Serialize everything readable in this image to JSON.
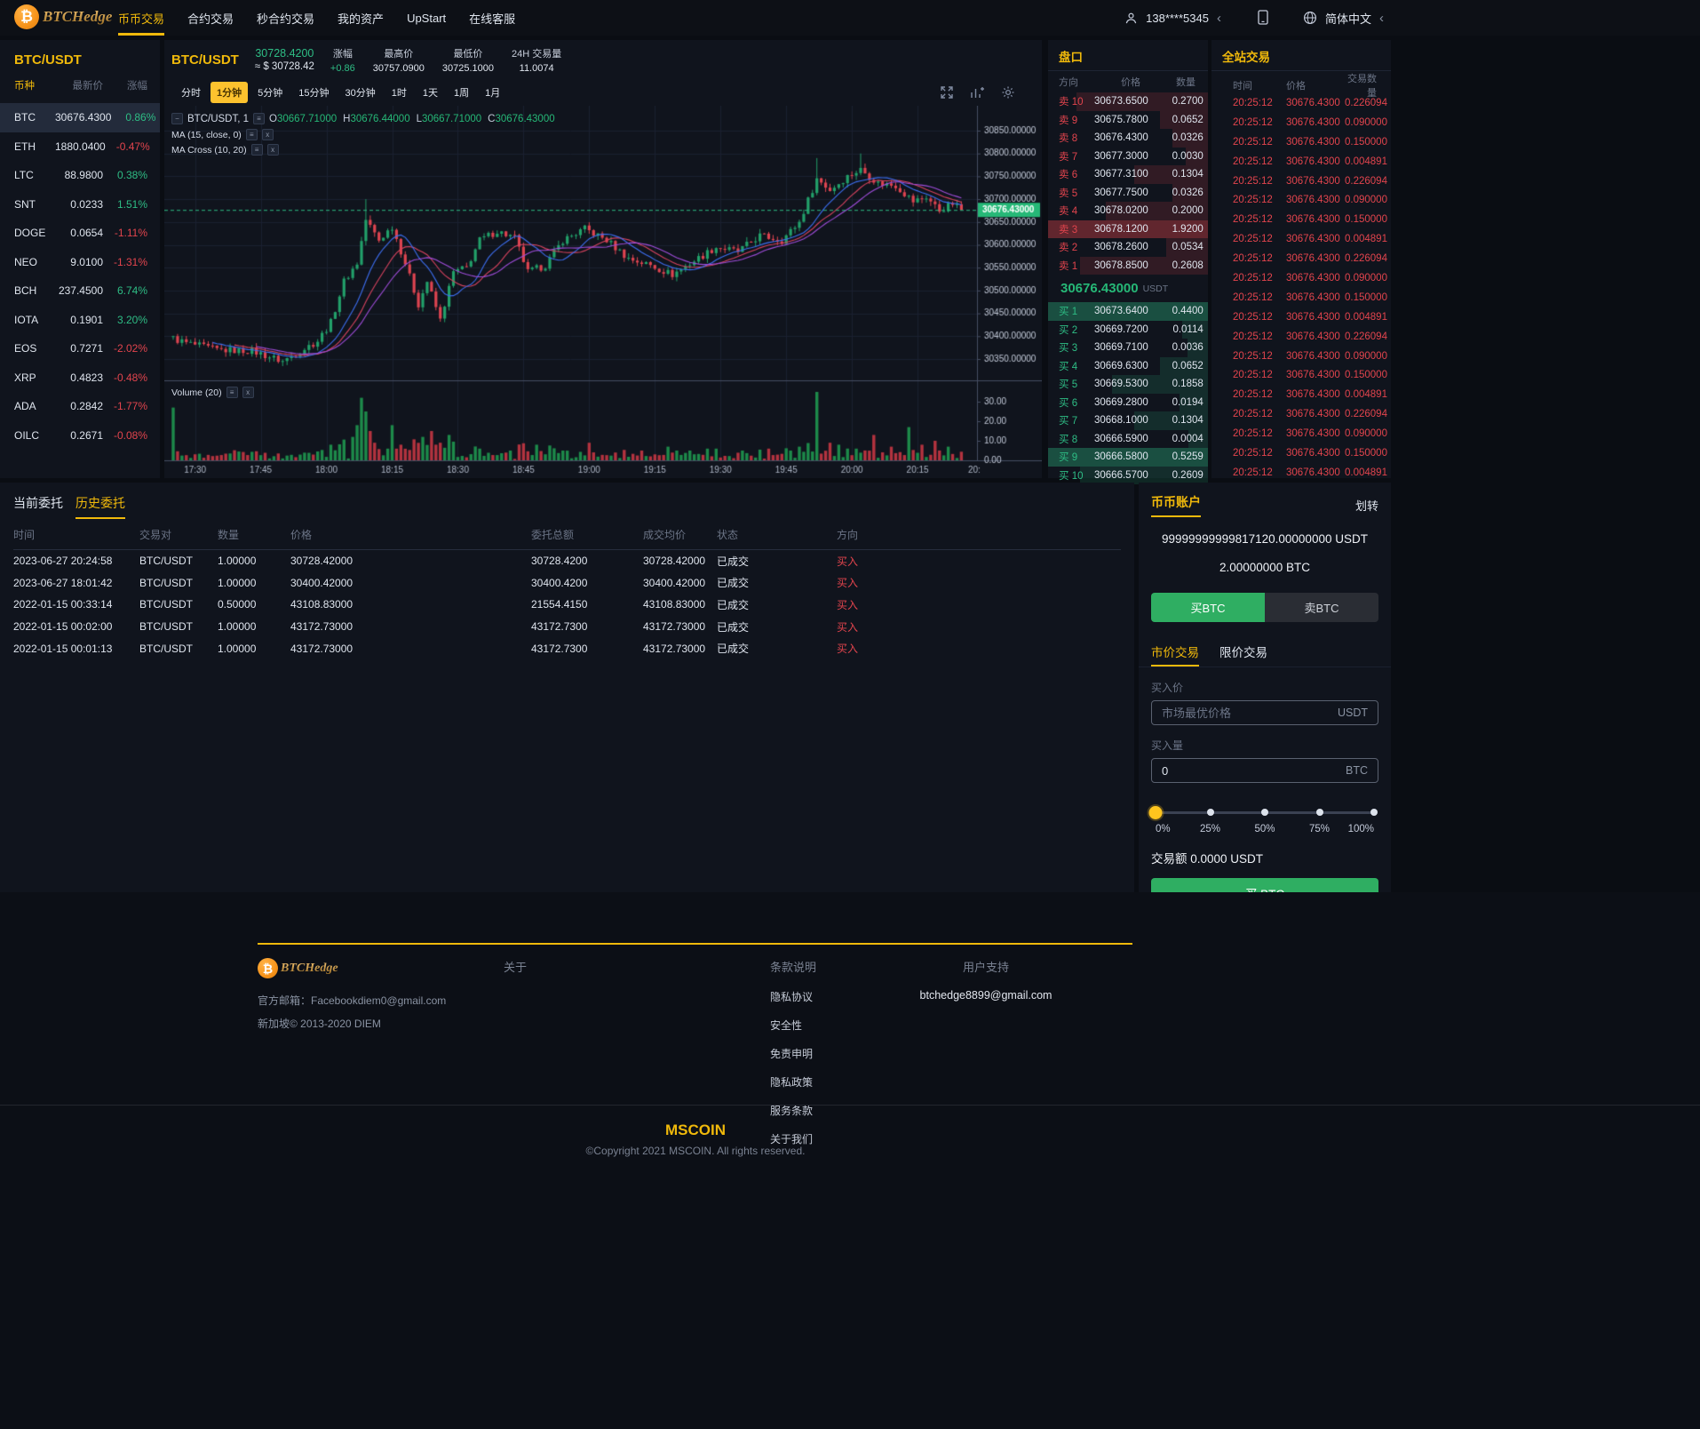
{
  "navbar": {
    "brand": "BTCHedge",
    "items": [
      {
        "label": "币币交易",
        "active": true
      },
      {
        "label": "合约交易",
        "active": false
      },
      {
        "label": "秒合约交易",
        "active": false
      },
      {
        "label": "我的资产",
        "active": false
      },
      {
        "label": "UpStart",
        "active": false
      },
      {
        "label": "在线客服",
        "active": false
      }
    ],
    "user": "138****5345",
    "language": "简体中文"
  },
  "sidebar": {
    "title": "BTC/USDT",
    "headers": [
      "币种",
      "最新价",
      "涨幅"
    ],
    "coins": [
      {
        "symbol": "BTC",
        "price": "30676.4300",
        "change": "0.86%",
        "dir": "up",
        "selected": true
      },
      {
        "symbol": "ETH",
        "price": "1880.0400",
        "change": "-0.47%",
        "dir": "down",
        "selected": false
      },
      {
        "symbol": "LTC",
        "price": "88.9800",
        "change": "0.38%",
        "dir": "up",
        "selected": false
      },
      {
        "symbol": "SNT",
        "price": "0.0233",
        "change": "1.51%",
        "dir": "up",
        "selected": false
      },
      {
        "symbol": "DOGE",
        "price": "0.0654",
        "change": "-1.11%",
        "dir": "down",
        "selected": false
      },
      {
        "symbol": "NEO",
        "price": "9.0100",
        "change": "-1.31%",
        "dir": "down",
        "selected": false
      },
      {
        "symbol": "BCH",
        "price": "237.4500",
        "change": "6.74%",
        "dir": "up",
        "selected": false
      },
      {
        "symbol": "IOTA",
        "price": "0.1901",
        "change": "3.20%",
        "dir": "up",
        "selected": false
      },
      {
        "symbol": "EOS",
        "price": "0.7271",
        "change": "-2.02%",
        "dir": "down",
        "selected": false
      },
      {
        "symbol": "XRP",
        "price": "0.4823",
        "change": "-0.48%",
        "dir": "down",
        "selected": false
      },
      {
        "symbol": "ADA",
        "price": "0.2842",
        "change": "-1.77%",
        "dir": "down",
        "selected": false
      },
      {
        "symbol": "OILC",
        "price": "0.2671",
        "change": "-0.08%",
        "dir": "down",
        "selected": false
      }
    ]
  },
  "chart_header": {
    "pair": "BTC/USDT",
    "price": "30728.4200",
    "approx": "≈ $ 30728.42",
    "stats": [
      {
        "label": "涨幅",
        "value": "+0.86",
        "green": true
      },
      {
        "label": "最高价",
        "value": "30757.0900",
        "green": false
      },
      {
        "label": "最低价",
        "value": "30725.1000",
        "green": false
      },
      {
        "label": "24H 交易量",
        "value": "11.0074",
        "green": false
      }
    ]
  },
  "timeframes": [
    "分时",
    "1分钟",
    "5分钟",
    "15分钟",
    "30分钟",
    "1时",
    "1天",
    "1周",
    "1月"
  ],
  "active_timeframe": "1分钟",
  "chart": {
    "legend_pair": "BTC/USDT, 1",
    "ohlc": {
      "o": "30667.71000",
      "h": "30676.44000",
      "l": "30667.71000",
      "c": "30676.43000"
    },
    "ma1_legend": "MA (15, close, 0)",
    "ma2_legend": "MA Cross (10, 20)",
    "volume_legend": "Volume (20)",
    "last_price": "30676.43000",
    "price_ticks": [
      "30850.00000",
      "30800.00000",
      "30750.00000",
      "30700.00000",
      "30650.00000",
      "30600.00000",
      "30550.00000",
      "30500.00000",
      "30450.00000",
      "30400.00000",
      "30350.00000"
    ],
    "volume_ticks": [
      "30.00",
      "20.00",
      "10.00",
      "0.00"
    ],
    "time_ticks": [
      "17:30",
      "17:45",
      "18:00",
      "18:15",
      "18:30",
      "18:45",
      "19:00",
      "19:15",
      "19:30",
      "19:45",
      "20:00",
      "20:15"
    ],
    "edge_time_tick": "20:",
    "waypoints": [
      [
        0,
        30395
      ],
      [
        3,
        30385
      ],
      [
        10,
        30370
      ],
      [
        18,
        30368
      ],
      [
        25,
        30345
      ],
      [
        33,
        30390
      ],
      [
        36,
        30430
      ],
      [
        39,
        30520
      ],
      [
        42,
        30560
      ],
      [
        44,
        30655
      ],
      [
        47,
        30610
      ],
      [
        50,
        30640
      ],
      [
        53,
        30560
      ],
      [
        56,
        30470
      ],
      [
        58,
        30520
      ],
      [
        61,
        30435
      ],
      [
        64,
        30540
      ],
      [
        67,
        30550
      ],
      [
        70,
        30610
      ],
      [
        74,
        30630
      ],
      [
        78,
        30615
      ],
      [
        81,
        30540
      ],
      [
        85,
        30555
      ],
      [
        89,
        30610
      ],
      [
        94,
        30635
      ],
      [
        99,
        30610
      ],
      [
        104,
        30570
      ],
      [
        109,
        30555
      ],
      [
        114,
        30535
      ],
      [
        119,
        30565
      ],
      [
        124,
        30595
      ],
      [
        129,
        30585
      ],
      [
        134,
        30620
      ],
      [
        139,
        30610
      ],
      [
        143,
        30650
      ],
      [
        147,
        30745
      ],
      [
        150,
        30720
      ],
      [
        154,
        30750
      ],
      [
        157,
        30765
      ],
      [
        161,
        30735
      ],
      [
        165,
        30730
      ],
      [
        169,
        30695
      ],
      [
        172,
        30705
      ],
      [
        175,
        30675
      ],
      [
        178,
        30690
      ],
      [
        180,
        30676.43
      ]
    ],
    "volume_spikes": {
      "0": 27,
      "41": 12,
      "42": 18,
      "43": 32,
      "44": 25,
      "45": 15,
      "46": 9,
      "50": 18,
      "52": 8,
      "57": 12,
      "59": 15,
      "61": 9,
      "63": 13,
      "70": 6,
      "77": 5,
      "83": 8,
      "89": 5,
      "95": 9,
      "101": 4,
      "107": 5,
      "113": 7,
      "118": 5,
      "124": 6,
      "130": 5,
      "136": 6,
      "141": 5,
      "143": 7,
      "147": 35,
      "150": 9,
      "152": 8,
      "156": 6,
      "160": 13,
      "164": 7,
      "168": 17,
      "171": 8,
      "174": 10,
      "177": 7
    }
  },
  "order_book": {
    "title": "盘口",
    "headers": [
      "方向",
      "价格",
      "数量"
    ],
    "asks": [
      {
        "label": "卖 10",
        "price": "30673.6500",
        "qty": "0.2700",
        "depth": 82,
        "hl": false
      },
      {
        "label": "卖 9",
        "price": "30675.7800",
        "qty": "0.0652",
        "depth": 30,
        "hl": false
      },
      {
        "label": "卖 8",
        "price": "30676.4300",
        "qty": "0.0326",
        "depth": 22,
        "hl": false
      },
      {
        "label": "卖 7",
        "price": "30677.3000",
        "qty": "0.0030",
        "depth": 14,
        "hl": false
      },
      {
        "label": "卖 6",
        "price": "30677.3100",
        "qty": "0.1304",
        "depth": 46,
        "hl": false
      },
      {
        "label": "卖 5",
        "price": "30677.7500",
        "qty": "0.0326",
        "depth": 22,
        "hl": false
      },
      {
        "label": "卖 4",
        "price": "30678.0200",
        "qty": "0.2000",
        "depth": 64,
        "hl": false
      },
      {
        "label": "卖 3",
        "price": "30678.1200",
        "qty": "1.9200",
        "depth": 100,
        "hl": true
      },
      {
        "label": "卖 2",
        "price": "30678.2600",
        "qty": "0.0534",
        "depth": 26,
        "hl": false
      },
      {
        "label": "卖 1",
        "price": "30678.8500",
        "qty": "0.2608",
        "depth": 80,
        "hl": false
      }
    ],
    "current_price": "30676.43000",
    "current_unit": "USDT",
    "bids": [
      {
        "label": "买 1",
        "price": "30673.6400",
        "qty": "0.4400",
        "depth": 100,
        "hl": true
      },
      {
        "label": "买 2",
        "price": "30669.7200",
        "qty": "0.0114",
        "depth": 16,
        "hl": false
      },
      {
        "label": "买 3",
        "price": "30669.7100",
        "qty": "0.0036",
        "depth": 13,
        "hl": false
      },
      {
        "label": "买 4",
        "price": "30669.6300",
        "qty": "0.0652",
        "depth": 30,
        "hl": false
      },
      {
        "label": "买 5",
        "price": "30669.5300",
        "qty": "0.1858",
        "depth": 60,
        "hl": false
      },
      {
        "label": "买 6",
        "price": "30669.2800",
        "qty": "0.0194",
        "depth": 18,
        "hl": false
      },
      {
        "label": "买 7",
        "price": "30668.1000",
        "qty": "0.1304",
        "depth": 46,
        "hl": false
      },
      {
        "label": "买 8",
        "price": "30666.5900",
        "qty": "0.0004",
        "depth": 12,
        "hl": false
      },
      {
        "label": "买 9",
        "price": "30666.5800",
        "qty": "0.5259",
        "depth": 100,
        "hl": true
      },
      {
        "label": "买 10",
        "price": "30666.5700",
        "qty": "0.2609",
        "depth": 80,
        "hl": false
      }
    ]
  },
  "trades": {
    "title": "全站交易",
    "headers": [
      "时间",
      "价格",
      "交易数量"
    ],
    "time": "20:25:12",
    "price": "30676.4300",
    "qty_cycle": [
      "0.226094",
      "0.090000",
      "0.150000",
      "0.004891"
    ],
    "row_count": 20
  },
  "orders": {
    "tabs": [
      {
        "label": "当前委托",
        "active": false
      },
      {
        "label": "历史委托",
        "active": true
      }
    ],
    "headers": [
      "时间",
      "交易对",
      "数量",
      "价格",
      "委托总额",
      "成交均价",
      "状态",
      "方向"
    ],
    "rows": [
      [
        "2023-06-27 20:24:58",
        "BTC/USDT",
        "1.00000",
        "30728.42000",
        "30728.4200",
        "30728.42000",
        "已成交",
        "买入"
      ],
      [
        "2023-06-27 18:01:42",
        "BTC/USDT",
        "1.00000",
        "30400.42000",
        "30400.4200",
        "30400.42000",
        "已成交",
        "买入"
      ],
      [
        "2022-01-15 00:33:14",
        "BTC/USDT",
        "0.50000",
        "43108.83000",
        "21554.4150",
        "43108.83000",
        "已成交",
        "买入"
      ],
      [
        "2022-01-15 00:02:00",
        "BTC/USDT",
        "1.00000",
        "43172.73000",
        "43172.7300",
        "43172.73000",
        "已成交",
        "买入"
      ],
      [
        "2022-01-15 00:01:13",
        "BTC/USDT",
        "1.00000",
        "43172.73000",
        "43172.7300",
        "43172.73000",
        "已成交",
        "买入"
      ]
    ]
  },
  "trade_panel": {
    "title": "币币账户",
    "transfer": "划转",
    "balance_usdt": "99999999999817120.00000000 USDT",
    "balance_btc": "2.00000000 BTC",
    "buy_toggle": "买BTC",
    "sell_toggle": "卖BTC",
    "order_tabs": [
      {
        "label": "市价交易",
        "active": true
      },
      {
        "label": "限价交易",
        "active": false
      }
    ],
    "buy_price_label": "买入价",
    "price_placeholder": "市场最优价格",
    "price_unit": "USDT",
    "amount_label": "买入量",
    "amount_value": "0",
    "amount_unit": "BTC",
    "percents": [
      "0%",
      "25%",
      "50%",
      "75%",
      "100%"
    ],
    "total_line": "交易额 0.0000 USDT",
    "submit": "买 BTC"
  },
  "footer": {
    "brand": "BTCHedge",
    "email_line": "官方邮箱：Facebookdiem0@gmail.com",
    "copyright_line": "新加坡© 2013-2020 DIEM",
    "col2_title": "关于",
    "col3_title": "条款说明",
    "col3_links": [
      "隐私协议",
      "安全性",
      "免责申明",
      "隐私政策",
      "服务条款",
      "关于我们"
    ],
    "col4_title": "用户支持",
    "col4_email": "btchedge8899@gmail.com",
    "bottom_brand": "MSCOIN",
    "bottom_copyright": "©Copyright 2021 MSCOIN. All rights reserved."
  },
  "colors": {
    "accent": "#f0b90b",
    "green": "#2ebd85",
    "red": "#e2444d",
    "candle_up": "#22a06a",
    "candle_down": "#dd4450",
    "vol_up": "#1d8a4a",
    "vol_down": "#b3333f",
    "ma10": "#3d6ff2",
    "ma15": "#d8435f",
    "ma20": "#a04ddb",
    "grid": "#1a2130",
    "axis": "#454e63",
    "price_label_bg": "#26b877"
  }
}
